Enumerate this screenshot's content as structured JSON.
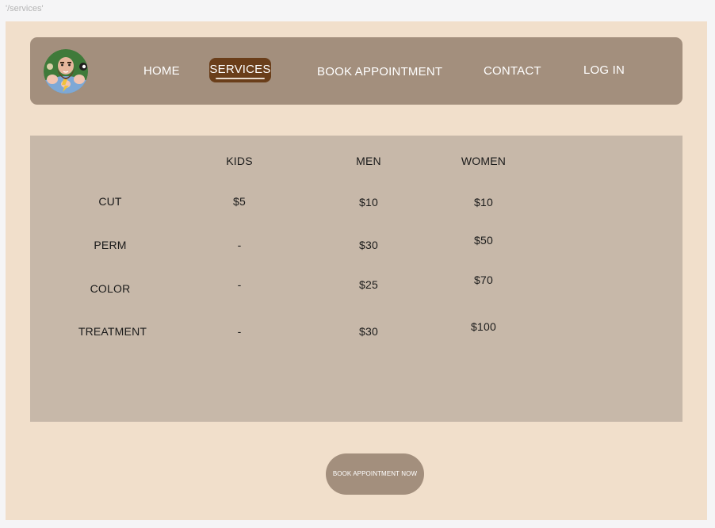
{
  "route": "'/services'",
  "nav": {
    "logo_icon": "barber-avatar-icon",
    "items": [
      "HOME",
      "SERVICES",
      "BOOK APPOINTMENT",
      "CONTACT",
      "LOG IN"
    ],
    "active": "SERVICES"
  },
  "prices": {
    "columns": [
      "KIDS",
      "MEN",
      "WOMEN"
    ],
    "rows": [
      {
        "service": "CUT",
        "kids": "$5",
        "men": "$10",
        "women": "$10"
      },
      {
        "service": "PERM",
        "kids": "-",
        "men": "$30",
        "women": "$50"
      },
      {
        "service": "COLOR",
        "kids": "-",
        "men": "$25",
        "women": "$70"
      },
      {
        "service": "TREATMENT",
        "kids": "-",
        "men": "$30",
        "women": "$100"
      }
    ]
  },
  "cta": {
    "label": "BOOK APPOINTMENT NOW"
  },
  "colors": {
    "page_bg": "#f1dfcb",
    "nav_bg": "#a38f7d",
    "active_bg": "#6a3e1a",
    "panel_bg": "#c7b8a9"
  }
}
